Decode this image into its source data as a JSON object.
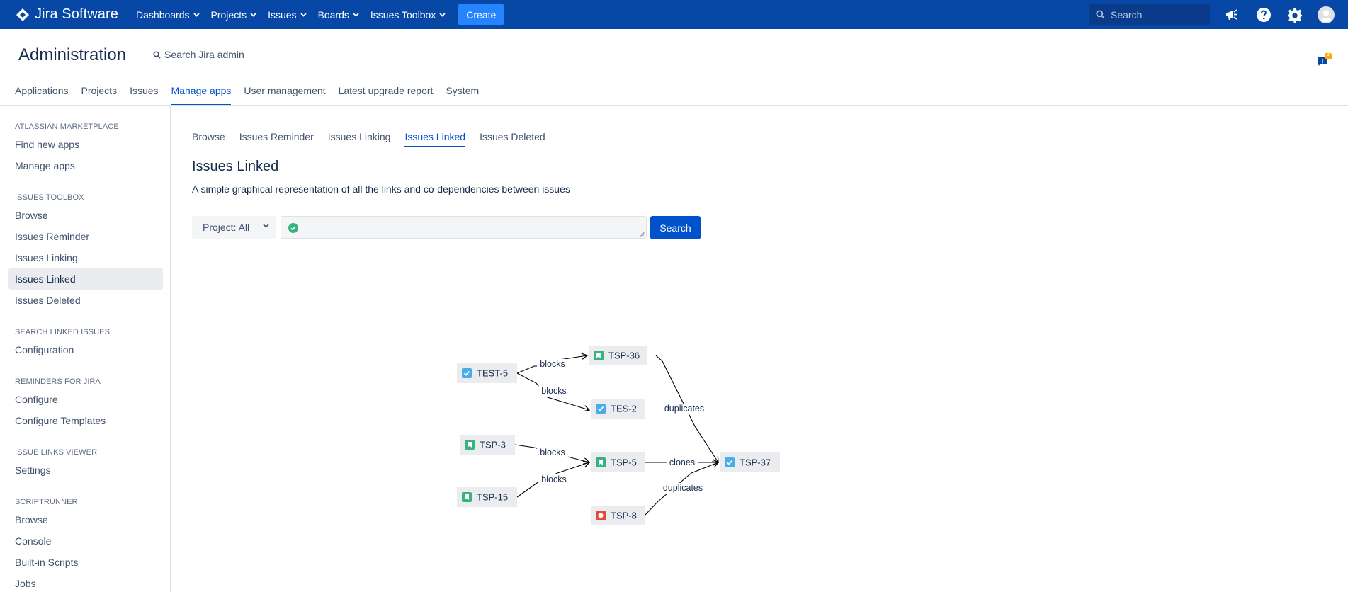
{
  "topnav": {
    "logo_text": "Jira Software",
    "menu": [
      {
        "label": "Dashboards",
        "has_dropdown": true
      },
      {
        "label": "Projects",
        "has_dropdown": true
      },
      {
        "label": "Issues",
        "has_dropdown": true
      },
      {
        "label": "Boards",
        "has_dropdown": true
      },
      {
        "label": "Issues Toolbox",
        "has_dropdown": true
      }
    ],
    "create_label": "Create",
    "search_placeholder": "Search",
    "icons": [
      "megaphone-icon",
      "help-icon",
      "gear-icon",
      "avatar"
    ],
    "bg_color": "#0747a6",
    "create_color": "#2684ff"
  },
  "admin": {
    "title": "Administration",
    "search_label": "Search Jira admin",
    "feedback_badge": "3",
    "tabs": [
      {
        "label": "Applications",
        "active": false
      },
      {
        "label": "Projects",
        "active": false
      },
      {
        "label": "Issues",
        "active": false
      },
      {
        "label": "Manage apps",
        "active": true
      },
      {
        "label": "User management",
        "active": false
      },
      {
        "label": "Latest upgrade report",
        "active": false
      },
      {
        "label": "System",
        "active": false
      }
    ]
  },
  "sidebar": {
    "sections": [
      {
        "heading": "ATLASSIAN MARKETPLACE",
        "items": [
          "Find new apps",
          "Manage apps"
        ]
      },
      {
        "heading": "ISSUES TOOLBOX",
        "items": [
          "Browse",
          "Issues Reminder",
          "Issues Linking",
          "Issues Linked",
          "Issues Deleted"
        ]
      },
      {
        "heading": "SEARCH LINKED ISSUES",
        "items": [
          "Configuration"
        ]
      },
      {
        "heading": "REMINDERS FOR JIRA",
        "items": [
          "Configure",
          "Configure Templates"
        ]
      },
      {
        "heading": "ISSUE LINKS VIEWER",
        "items": [
          "Settings"
        ]
      },
      {
        "heading": "SCRIPTRUNNER",
        "items": [
          "Browse",
          "Console",
          "Built-in Scripts",
          "Jobs"
        ]
      }
    ],
    "active_item": "Issues Linked"
  },
  "main": {
    "tabs": [
      {
        "label": "Browse",
        "active": false
      },
      {
        "label": "Issues Reminder",
        "active": false
      },
      {
        "label": "Issues Linking",
        "active": false
      },
      {
        "label": "Issues Linked",
        "active": true
      },
      {
        "label": "Issues Deleted",
        "active": false
      }
    ],
    "title": "Issues Linked",
    "description": "A simple graphical representation of all the links and co-dependencies between issues",
    "project_filter": "Project: All",
    "jql_value": "",
    "search_button": "Search"
  },
  "graph": {
    "nodes": [
      {
        "key": "TEST-5",
        "type": "task"
      },
      {
        "key": "TSP-36",
        "type": "story"
      },
      {
        "key": "TES-2",
        "type": "task"
      },
      {
        "key": "TSP-3",
        "type": "story"
      },
      {
        "key": "TSP-5",
        "type": "story"
      },
      {
        "key": "TSP-15",
        "type": "story"
      },
      {
        "key": "TSP-8",
        "type": "bug"
      },
      {
        "key": "TSP-37",
        "type": "task"
      }
    ],
    "edges": [
      {
        "from": "TEST-5",
        "to": "TSP-36",
        "label": "blocks"
      },
      {
        "from": "TEST-5",
        "to": "TES-2",
        "label": "blocks"
      },
      {
        "from": "TSP-3",
        "to": "TSP-5",
        "label": "blocks"
      },
      {
        "from": "TSP-15",
        "to": "TSP-5",
        "label": "blocks"
      },
      {
        "from": "TSP-36",
        "to": "TSP-37",
        "label": "duplicates"
      },
      {
        "from": "TSP-5",
        "to": "TSP-37",
        "label": "clones"
      },
      {
        "from": "TSP-8",
        "to": "TSP-37",
        "label": "duplicates"
      }
    ],
    "type_colors": {
      "task": "#4bade8",
      "story": "#36b37e",
      "bug": "#e5493a"
    }
  }
}
